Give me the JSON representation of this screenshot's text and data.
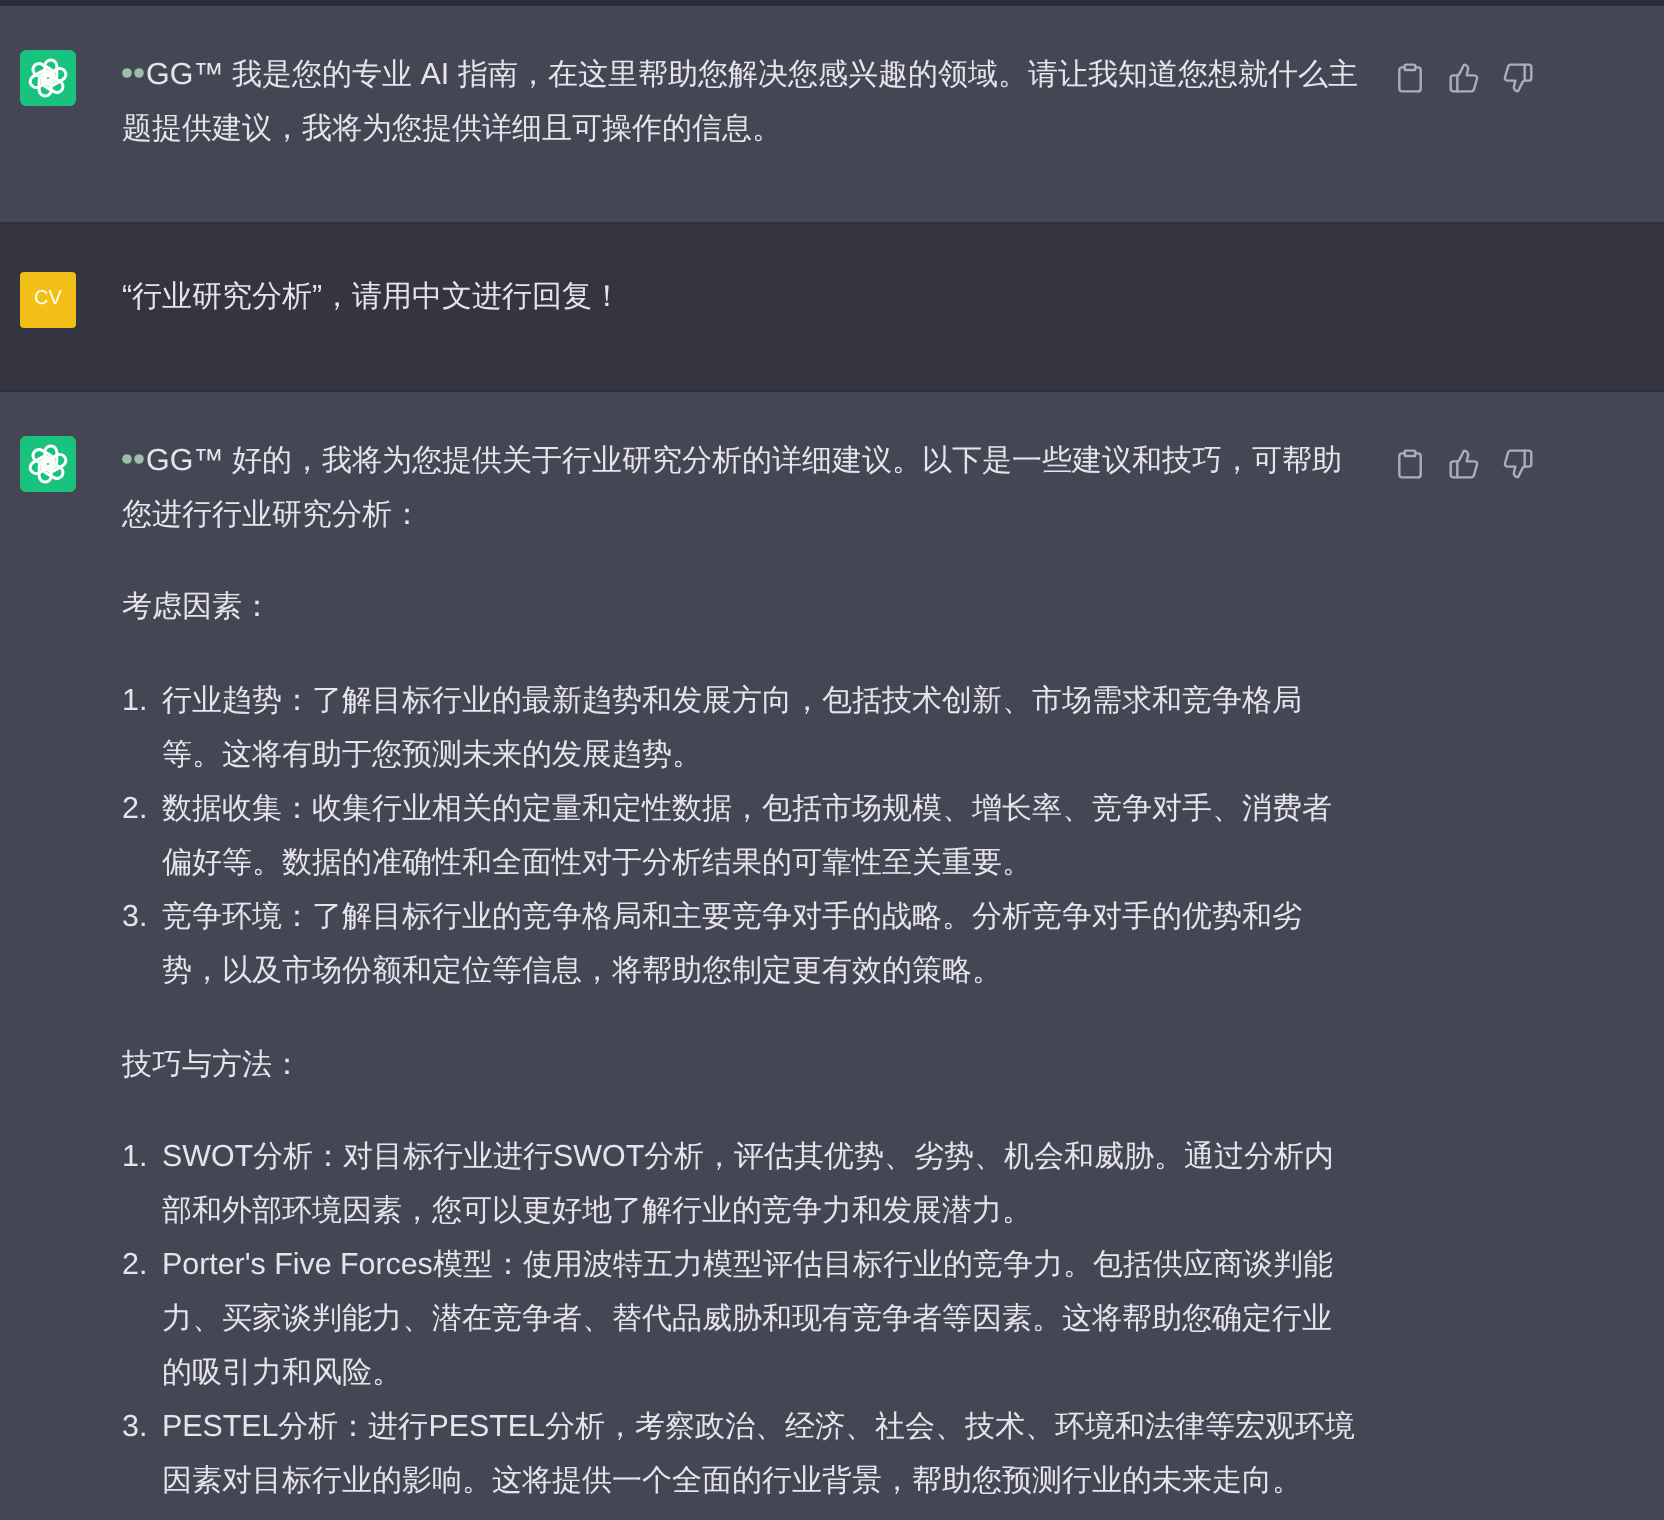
{
  "messages": [
    {
      "kind": "assistant",
      "blocks": [
        {
          "kind": "paragraph",
          "prefix_icon": true,
          "text": "GG™ 我是您的专业 AI 指南，在这里帮助您解决您感兴趣的领域。请让我知道您想就什么主题提供建议，我将为您提供详细且可操作的信息。"
        }
      ]
    },
    {
      "kind": "user",
      "avatar": "CV",
      "blocks": [
        {
          "kind": "paragraph",
          "text": "“行业研究分析”，请用中文进行回复！"
        }
      ]
    },
    {
      "kind": "assistant",
      "blocks": [
        {
          "kind": "paragraph",
          "prefix_icon": true,
          "text": "GG™ 好的，我将为您提供关于行业研究分析的详细建议。以下是一些建议和技巧，可帮助您进行行业研究分析："
        },
        {
          "kind": "paragraph",
          "text": "考虑因素："
        },
        {
          "kind": "list",
          "items": [
            {
              "number": "1.",
              "text": "行业趋势：了解目标行业的最新趋势和发展方向，包括技术创新、市场需求和竞争格局等。这将有助于您预测未来的发展趋势。"
            },
            {
              "number": "2.",
              "text": "数据收集：收集行业相关的定量和定性数据，包括市场规模、增长率、竞争对手、消费者偏好等。数据的准确性和全面性对于分析结果的可靠性至关重要。"
            },
            {
              "number": "3.",
              "text": "竞争环境：了解目标行业的竞争格局和主要竞争对手的战略。分析竞争对手的优势和劣势，以及市场份额和定位等信息，将帮助您制定更有效的策略。"
            }
          ]
        },
        {
          "kind": "paragraph",
          "text": "技巧与方法："
        },
        {
          "kind": "list",
          "items": [
            {
              "number": "1.",
              "text": "SWOT分析：对目标行业进行SWOT分析，评估其优势、劣势、机会和威胁。通过分析内部和外部环境因素，您可以更好地了解行业的竞争力和发展潜力。"
            },
            {
              "number": "2.",
              "text": "Porter's Five Forces模型：使用波特五力模型评估目标行业的竞争力。包括供应商谈判能力、买家谈判能力、潜在竞争者、替代品威胁和现有竞争者等因素。这将帮助您确定行业的吸引力和风险。"
            },
            {
              "number": "3.",
              "text": "PESTEL分析：进行PESTEL分析，考察政治、经济、社会、技术、环境和法律等宏观环境因素对目标行业的影响。这将提供一个全面的行业背景，帮助您预测行业的未来走向。"
            }
          ]
        }
      ]
    }
  ]
}
